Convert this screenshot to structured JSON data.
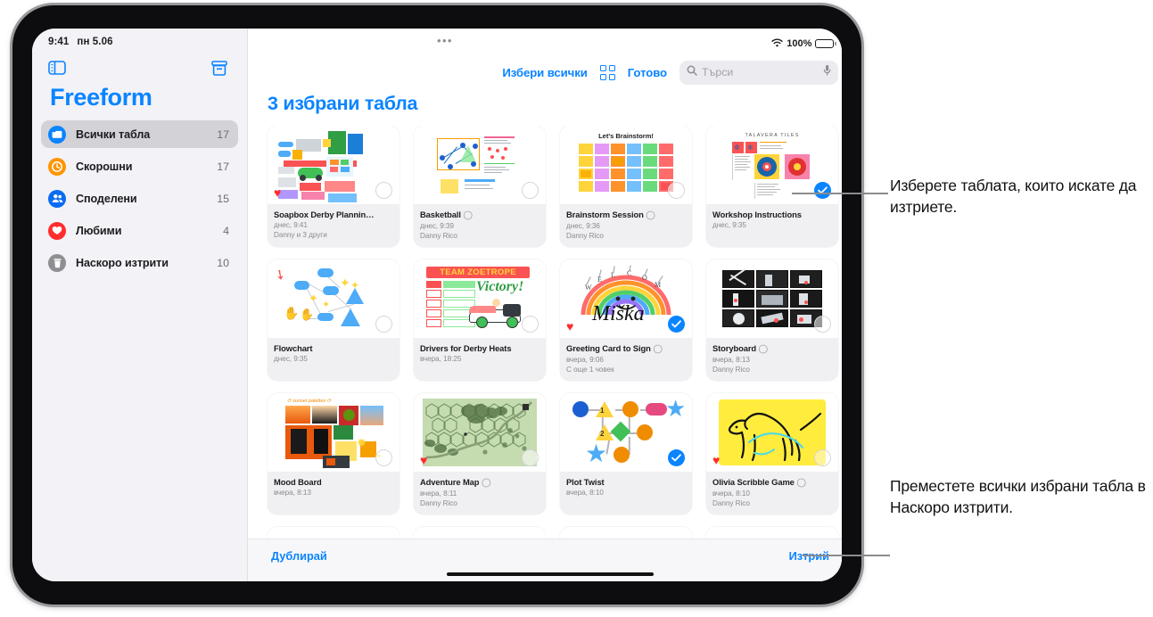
{
  "device": {
    "platform": "ipad"
  },
  "status_bar": {
    "time": "9:41",
    "date": "пн 5.06",
    "battery_pct": "100%",
    "wifi_icon": "wifi-icon"
  },
  "sidebar": {
    "app_title": "Freeform",
    "toggle_icon": "sidebar-toggle-icon",
    "archive_icon": "new-board-icon",
    "items": [
      {
        "label": "Всички табла",
        "count": "17",
        "icon": "all-boards-icon",
        "color": "#0a84ff",
        "selected": true
      },
      {
        "label": "Скорошни",
        "count": "17",
        "icon": "recents-clock-icon",
        "color": "#ff9500",
        "selected": false
      },
      {
        "label": "Споделени",
        "count": "15",
        "icon": "shared-people-icon",
        "color": "#0a6cf1",
        "selected": false
      },
      {
        "label": "Любими",
        "count": "4",
        "icon": "favorites-heart-icon",
        "color": "#ff2d2d",
        "selected": false
      },
      {
        "label": "Наскоро изтрити",
        "count": "10",
        "icon": "trash-icon",
        "color": "#8e8e93",
        "selected": false
      }
    ]
  },
  "toolbar": {
    "select_all_label": "Избери всички",
    "grid_view_icon": "grid-view-icon",
    "done_label": "Готово",
    "search_placeholder": "Търси",
    "search_value": "",
    "search_icon": "search-icon",
    "mic_icon": "microphone-icon"
  },
  "main": {
    "grid_title": "3 избрани табла",
    "accent_color": "#0a84ff"
  },
  "boards": [
    {
      "title": "Soapbox Derby Plannin…",
      "date": "днес, 9:41",
      "owner": "Danny и 3 други",
      "favorite": true,
      "selected": false,
      "comment": false,
      "art": "soapbox"
    },
    {
      "title": "Basketball",
      "date": "днес, 9:39",
      "owner": "Danny Rico",
      "favorite": false,
      "selected": false,
      "comment": true,
      "art": "basketball"
    },
    {
      "title": "Brainstorm Session",
      "date": "днес, 9:36",
      "owner": "Danny Rico",
      "favorite": false,
      "selected": false,
      "comment": true,
      "art": "brainstorm"
    },
    {
      "title": "Workshop Instructions",
      "date": "днес, 9:35",
      "owner": "",
      "favorite": false,
      "selected": true,
      "comment": false,
      "art": "workshop"
    },
    {
      "title": "Flowchart",
      "date": "днес, 9:35",
      "owner": "",
      "favorite": false,
      "selected": false,
      "comment": false,
      "art": "flowchart"
    },
    {
      "title": "Drivers for Derby Heats",
      "date": "вчера, 18:25",
      "owner": "",
      "favorite": false,
      "selected": false,
      "comment": false,
      "art": "derby"
    },
    {
      "title": "Greeting Card to Sign",
      "date": "вчера, 9:06",
      "owner": "С още 1 човек",
      "favorite": true,
      "selected": true,
      "comment": true,
      "art": "greeting"
    },
    {
      "title": "Storyboard",
      "date": "вчера, 8:13",
      "owner": "Danny Rico",
      "favorite": false,
      "selected": false,
      "comment": true,
      "art": "storyboard"
    },
    {
      "title": "Mood Board",
      "date": "вчера, 8:13",
      "owner": "",
      "favorite": false,
      "selected": false,
      "comment": false,
      "art": "moodboard"
    },
    {
      "title": "Adventure Map",
      "date": "вчера, 8:11",
      "owner": "Danny Rico",
      "favorite": true,
      "selected": false,
      "comment": true,
      "art": "map"
    },
    {
      "title": "Plot Twist",
      "date": "вчера, 8:10",
      "owner": "",
      "favorite": false,
      "selected": true,
      "comment": false,
      "art": "plot"
    },
    {
      "title": "Olivia Scribble Game",
      "date": "вчера, 8:10",
      "owner": "Danny Rico",
      "favorite": true,
      "selected": false,
      "comment": true,
      "art": "scribble"
    }
  ],
  "bottom_bar": {
    "duplicate_label": "Дублирай",
    "delete_label": "Изтрий"
  },
  "callouts": [
    {
      "id": "select-boards",
      "text": "Изберете таблата, които искате да изтриете."
    },
    {
      "id": "move-to-recently-deleted",
      "text": "Преместете всички избрани табла в Наскоро изтрити."
    }
  ]
}
